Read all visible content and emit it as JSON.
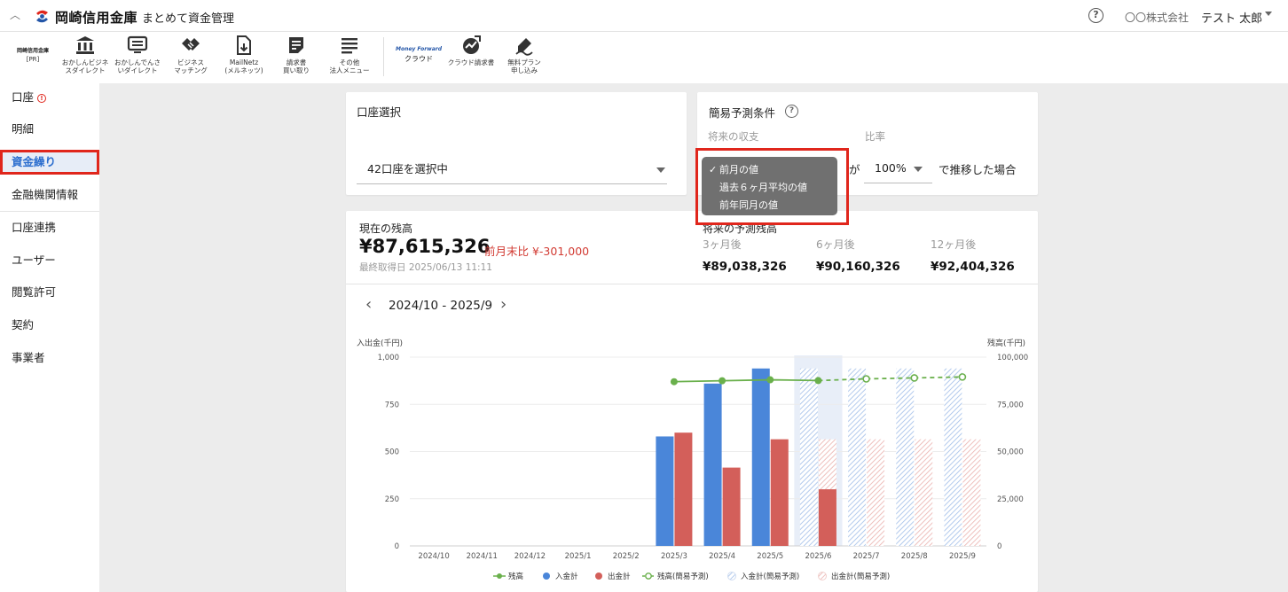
{
  "header": {
    "brand": "岡崎信用金庫",
    "app_title": "まとめて資金管理",
    "help_icon": "?",
    "company": "〇〇株式会社",
    "user": "テスト 太郎"
  },
  "toolbar": {
    "pr_name": "岡崎信用金庫",
    "pr_tag": "[PR]",
    "items": [
      {
        "icon": "bank-icon",
        "label": "おかしんビジネ\nスダイレクト"
      },
      {
        "icon": "monitor-icon",
        "label": "おかしんでんさ\nいダイレクト"
      },
      {
        "icon": "handshake-icon",
        "label": "ビジネス\nマッチング"
      },
      {
        "icon": "document-download-icon",
        "label": "MailNetz\n(メルネッツ)"
      },
      {
        "icon": "invoice-icon",
        "label": "請求書\n買い取り"
      },
      {
        "icon": "menu-icon",
        "label": "その他\n法人メニュー"
      }
    ],
    "mf_name": "Money Forward",
    "mf_sub": "クラウド",
    "cloud_items": [
      {
        "icon": "cloud-invoice-icon",
        "label": "クラウド請求書"
      },
      {
        "icon": "sign-icon",
        "label": "無料プラン\n申し込み"
      }
    ]
  },
  "sidebar": {
    "items": [
      {
        "label": "口座",
        "warning": "!"
      },
      {
        "label": "明細"
      },
      {
        "label": "資金繰り"
      },
      {
        "label": "金融機関情報"
      },
      {
        "label": "口座連携"
      },
      {
        "label": "ユーザー"
      },
      {
        "label": "閲覧許可"
      },
      {
        "label": "契約"
      },
      {
        "label": "事業者"
      }
    ]
  },
  "account_select": {
    "title": "口座選択",
    "value": "42口座を選択中"
  },
  "forecast": {
    "title": "簡易予測条件",
    "help_icon": "?",
    "future_label": "将来の収支",
    "ratio_label": "比率",
    "ga": "が",
    "ratio_value": "100%",
    "suffix": "で推移した場合",
    "check": "✓",
    "options": [
      "前月の値",
      "過去６ヶ月平均の値",
      "前年同月の値"
    ],
    "selected_index": 0
  },
  "balance": {
    "current_label": "現在の残高",
    "current_value": "¥87,615,326",
    "delta": "前月末比 ¥-301,000",
    "last_fetched": "最終取得日 2025/06/13 11:11",
    "future_label": "将来の予測残高",
    "future": [
      {
        "label": "3ヶ月後",
        "value": "¥89,038,326"
      },
      {
        "label": "6ヶ月後",
        "value": "¥90,160,326"
      },
      {
        "label": "12ヶ月後",
        "value": "¥92,404,326"
      }
    ]
  },
  "period": {
    "label": "2024/10 - 2025/9",
    "prev_icon": "‹",
    "next_icon": "›"
  },
  "colors": {
    "accent": "#2d6fcf",
    "income": "#4a86d9",
    "expense": "#d35f5a",
    "balance": "#6ab04c",
    "highlight": "#e0261c"
  },
  "chart_data": {
    "type": "bar",
    "ylabel_left": "入出金(千円)",
    "ylabel_right": "残高(千円)",
    "left_ticks": [
      "1,000",
      "750",
      "500",
      "250",
      "0"
    ],
    "right_ticks": [
      "100,000",
      "75,000",
      "50,000",
      "25,000",
      "0"
    ],
    "ylim_left": [
      0,
      1000
    ],
    "ylim_right": [
      0,
      100000
    ],
    "categories": [
      "2024/10",
      "2024/11",
      "2024/12",
      "2025/1",
      "2025/2",
      "2025/3",
      "2025/4",
      "2025/5",
      "2025/6",
      "2025/7",
      "2025/8",
      "2025/9"
    ],
    "highlight_category": "2025/6",
    "series": [
      {
        "name": "入金計",
        "kind": "bar",
        "axis": "left",
        "values": [
          null,
          null,
          null,
          null,
          null,
          580,
          860,
          940,
          null,
          null,
          null,
          null
        ]
      },
      {
        "name": "出金計",
        "kind": "bar",
        "axis": "left",
        "values": [
          null,
          null,
          null,
          null,
          null,
          600,
          415,
          565,
          300,
          null,
          null,
          null
        ]
      },
      {
        "name": "入金計(簡易予測)",
        "kind": "bar-forecast",
        "axis": "left",
        "values": [
          null,
          null,
          null,
          null,
          null,
          null,
          null,
          null,
          940,
          940,
          940,
          940
        ]
      },
      {
        "name": "出金計(簡易予測)",
        "kind": "bar-forecast",
        "axis": "left",
        "values": [
          null,
          null,
          null,
          null,
          null,
          null,
          null,
          null,
          565,
          565,
          565,
          565
        ]
      },
      {
        "name": "残高",
        "kind": "line",
        "axis": "right",
        "values": [
          null,
          null,
          null,
          null,
          null,
          87000,
          87500,
          88000,
          87600,
          null,
          null,
          null
        ]
      },
      {
        "name": "残高(簡易予測)",
        "kind": "line-dashed",
        "axis": "right",
        "values": [
          null,
          null,
          null,
          null,
          null,
          null,
          null,
          null,
          87600,
          88500,
          89000,
          89500
        ]
      }
    ],
    "legend": [
      "残高",
      "入金計",
      "出金計",
      "残高(簡易予測)",
      "入金計(簡易予測)",
      "出金計(簡易予測)"
    ],
    "legend_position": "bottom",
    "grid": true
  }
}
